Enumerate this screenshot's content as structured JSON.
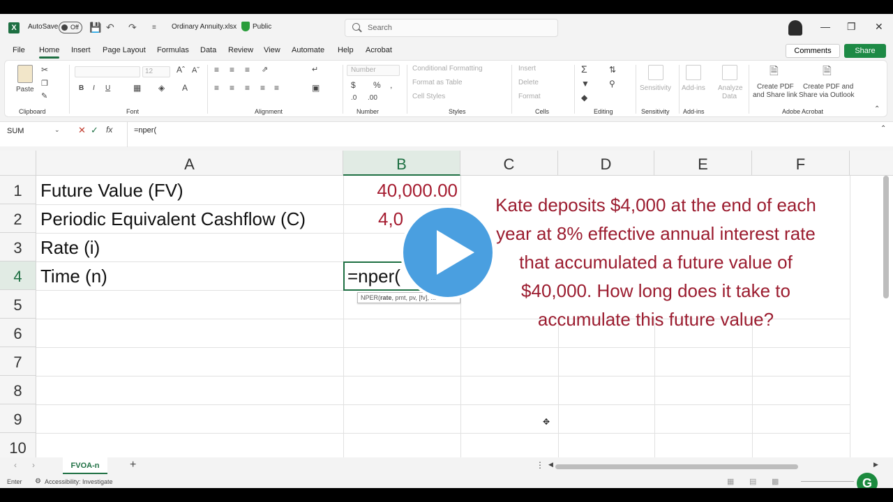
{
  "titlebar": {
    "autosave_label": "AutoSave",
    "autosave_state": "Off",
    "filename": "Ordinary Annuity.xlsx",
    "visibility": "Public",
    "search_placeholder": "Search"
  },
  "menu": {
    "items": [
      "File",
      "Home",
      "Insert",
      "Page Layout",
      "Formulas",
      "Data",
      "Review",
      "View",
      "Automate",
      "Help",
      "Acrobat"
    ],
    "active": "Home",
    "comments_label": "Comments",
    "share_label": "Share"
  },
  "ribbon": {
    "clipboard": {
      "paste": "Paste",
      "label": "Clipboard"
    },
    "font": {
      "label": "Font",
      "size": "12"
    },
    "alignment": {
      "label": "Alignment"
    },
    "number": {
      "format": "Number",
      "label": "Number"
    },
    "styles": {
      "conditional": "Conditional Formatting",
      "format_table": "Format as Table",
      "cell_styles": "Cell Styles",
      "label": "Styles"
    },
    "cells": {
      "insert": "Insert",
      "delete": "Delete",
      "format": "Format",
      "label": "Cells"
    },
    "editing": {
      "label": "Editing"
    },
    "sensitivity": {
      "button": "Sensitivity",
      "label": "Sensitivity"
    },
    "addins": {
      "button": "Add-ins",
      "label": "Add-ins"
    },
    "analyze": {
      "button_line1": "Analyze",
      "button_line2": "Data"
    },
    "acrobat": {
      "pdf_link_line1": "Create PDF",
      "pdf_link_line2": "and Share link",
      "pdf_outlook_line1": "Create PDF and",
      "pdf_outlook_line2": "Share via Outlook",
      "label": "Adobe Acrobat"
    }
  },
  "formula_bar": {
    "name_box": "SUM",
    "formula": "=nper("
  },
  "sheet": {
    "columns": [
      "A",
      "B",
      "C",
      "D",
      "E",
      "F"
    ],
    "rows": [
      "1",
      "2",
      "3",
      "4",
      "5",
      "6",
      "7",
      "8",
      "9",
      "10"
    ],
    "a1": "Future Value (FV)",
    "a2": "Periodic Equivalent Cashflow (C)",
    "a3": "Rate (i)",
    "a4": "Time (n)",
    "b1": "40,000.00",
    "b2": "4,0",
    "b4": "=nper(",
    "tooltip_fn": "NPER(",
    "tooltip_arg": "rate",
    "tooltip_rest": ", pmt, pv, [fv], ...",
    "question_lines": [
      "Kate deposits $4,000 at the end of each",
      "year at 8% effective annual interest rate",
      "that accumulated a future value of",
      "$40,000. How long does it take to",
      "accumulate this future value?"
    ]
  },
  "tabs": {
    "sheet_name": "FVOA-n",
    "add": "+"
  },
  "status": {
    "mode": "Enter",
    "accessibility": "Accessibility: Investigate"
  },
  "colors": {
    "excel_green": "#1d6f42",
    "value_red": "#a51c30",
    "play_blue": "#4a9fe0"
  }
}
